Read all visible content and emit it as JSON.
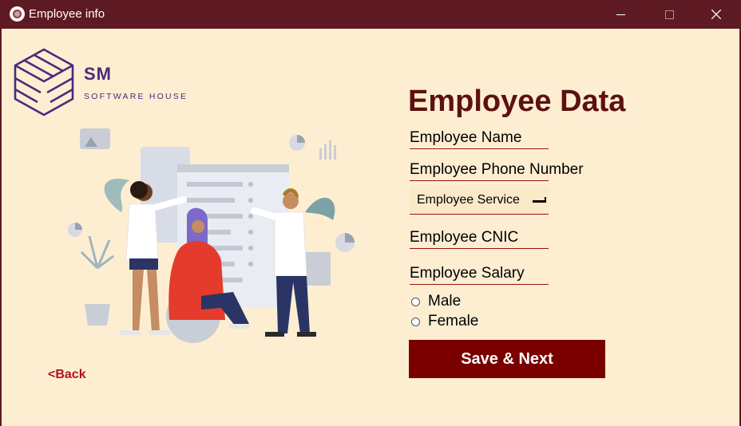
{
  "window": {
    "title": "Employee info"
  },
  "logo": {
    "mark": "SM",
    "subtitle": "SOFTWARE HOUSE"
  },
  "form": {
    "heading": "Employee Data",
    "name_label": "Employee Name",
    "phone_label": "Employee  Phone Number",
    "service_select": {
      "selected": "Employee Service"
    },
    "cnic_label": "Employee CNIC",
    "salary_label": "Employee Salary",
    "gender_options": [
      "Male",
      "Female"
    ],
    "save_label": "Save & Next"
  },
  "nav": {
    "back_label": "<Back"
  },
  "colors": {
    "titlebar": "#5e1a22",
    "background": "#fdeed2",
    "heading": "#5e1010",
    "button": "#7a0000",
    "link": "#b3111d",
    "logo": "#4b2a7a"
  }
}
